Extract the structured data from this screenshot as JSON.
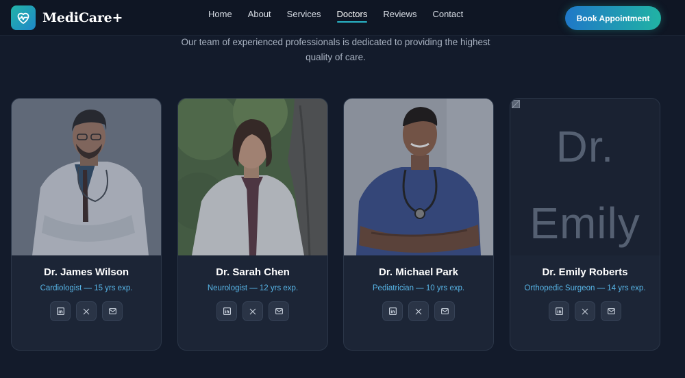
{
  "brand": {
    "name": "MediCare+"
  },
  "nav": {
    "links": [
      "Home",
      "About",
      "Services",
      "Doctors",
      "Reviews",
      "Contact"
    ],
    "active": "Doctors",
    "cta": "Book Appointment"
  },
  "section": {
    "subtitle": "Our team of experienced professionals is dedicated to providing the highest quality of care."
  },
  "doctors": [
    {
      "name": "Dr. James Wilson",
      "specialty": "Cardiologist — 15 yrs exp."
    },
    {
      "name": "Dr. Sarah Chen",
      "specialty": "Neurologist — 12 yrs exp."
    },
    {
      "name": "Dr. Michael Park",
      "specialty": "Pediatrician — 10 yrs exp."
    },
    {
      "name": "Dr. Emily Roberts",
      "specialty": "Orthopedic Surgeon — 14 yrs exp.",
      "image_alt": "Dr. Emily"
    }
  ],
  "social_icons": [
    "linkedin-icon",
    "x-icon",
    "mail-icon"
  ],
  "colors": {
    "background": "#131b2b",
    "navbar": "#0f1624",
    "card": "#1c2536",
    "accent_teal": "#21b3a4",
    "accent_blue": "#1f78c8",
    "specialty_text": "#58b6e8"
  }
}
